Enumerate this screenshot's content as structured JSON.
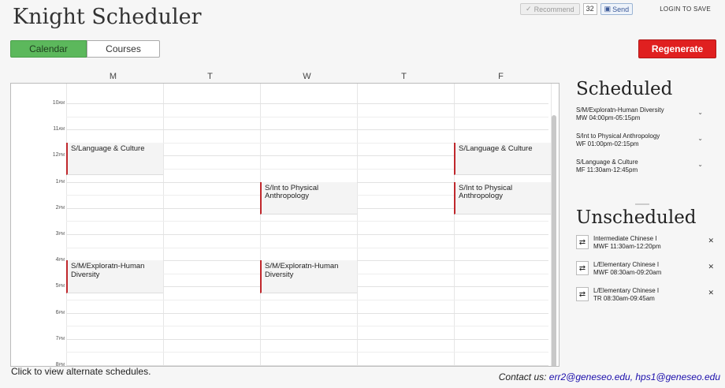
{
  "app": {
    "title": "Knight Scheduler"
  },
  "header": {
    "recommend_label": "Recommend",
    "recommend_count": "32",
    "send_label": "Send",
    "login_label": "LOGIN TO SAVE"
  },
  "tabs": [
    {
      "label": "Calendar",
      "active": true
    },
    {
      "label": "Courses",
      "active": false
    }
  ],
  "regenerate_label": "Regenerate",
  "calendar": {
    "days": [
      "M",
      "T",
      "W",
      "T",
      "F"
    ],
    "times": [
      {
        "hour": "10",
        "suffix": "AM"
      },
      {
        "hour": "11",
        "suffix": "AM"
      },
      {
        "hour": "12",
        "suffix": "PM"
      },
      {
        "hour": "1",
        "suffix": "PM"
      },
      {
        "hour": "2",
        "suffix": "PM"
      },
      {
        "hour": "3",
        "suffix": "PM"
      },
      {
        "hour": "4",
        "suffix": "PM"
      },
      {
        "hour": "5",
        "suffix": "PM"
      },
      {
        "hour": "6",
        "suffix": "PM"
      },
      {
        "hour": "7",
        "suffix": "PM"
      },
      {
        "hour": "8",
        "suffix": "PM"
      }
    ],
    "events": [
      {
        "title": "S/Language & Culture",
        "day": "M",
        "start": "11:30am",
        "end": "12:45pm"
      },
      {
        "title": "S/Language & Culture",
        "day": "F",
        "start": "11:30am",
        "end": "12:45pm"
      },
      {
        "title": "S/Int to Physical Anthropology",
        "day": "W",
        "start": "01:00pm",
        "end": "02:15pm"
      },
      {
        "title": "S/Int to Physical Anthropology",
        "day": "F",
        "start": "01:00pm",
        "end": "02:15pm"
      },
      {
        "title": "S/M/Exploratn-Human Diversity",
        "day": "M",
        "start": "04:00pm",
        "end": "05:15pm"
      },
      {
        "title": "S/M/Exploratn-Human Diversity",
        "day": "W",
        "start": "04:00pm",
        "end": "05:15pm"
      }
    ]
  },
  "hint": "Click to view alternate schedules.",
  "contact": {
    "label": "Contact us:",
    "emails": "err2@geneseo.edu, hps1@geneseo.edu"
  },
  "scheduled": {
    "heading": "Scheduled",
    "items": [
      {
        "name": "S/M/Exploratn-Human Diversity",
        "time": "MW 04:00pm-05:15pm"
      },
      {
        "name": "S/Int to Physical Anthropology",
        "time": "WF 01:00pm-02:15pm"
      },
      {
        "name": "S/Language & Culture",
        "time": "MF 11:30am-12:45pm"
      }
    ]
  },
  "unscheduled": {
    "heading": "Unscheduled",
    "items": [
      {
        "name": "Intermediate Chinese I",
        "time": "MWF 11:30am-12:20pm"
      },
      {
        "name": "L/Elementary Chinese I",
        "time": "MWF 08:30am-09:20am"
      },
      {
        "name": "L/Elementary Chinese I",
        "time": "TR 08:30am-09:45am"
      }
    ]
  },
  "colors": {
    "accent_green": "#5cb85c",
    "regenerate_red": "#e02020",
    "event_border": "#c0282d"
  }
}
